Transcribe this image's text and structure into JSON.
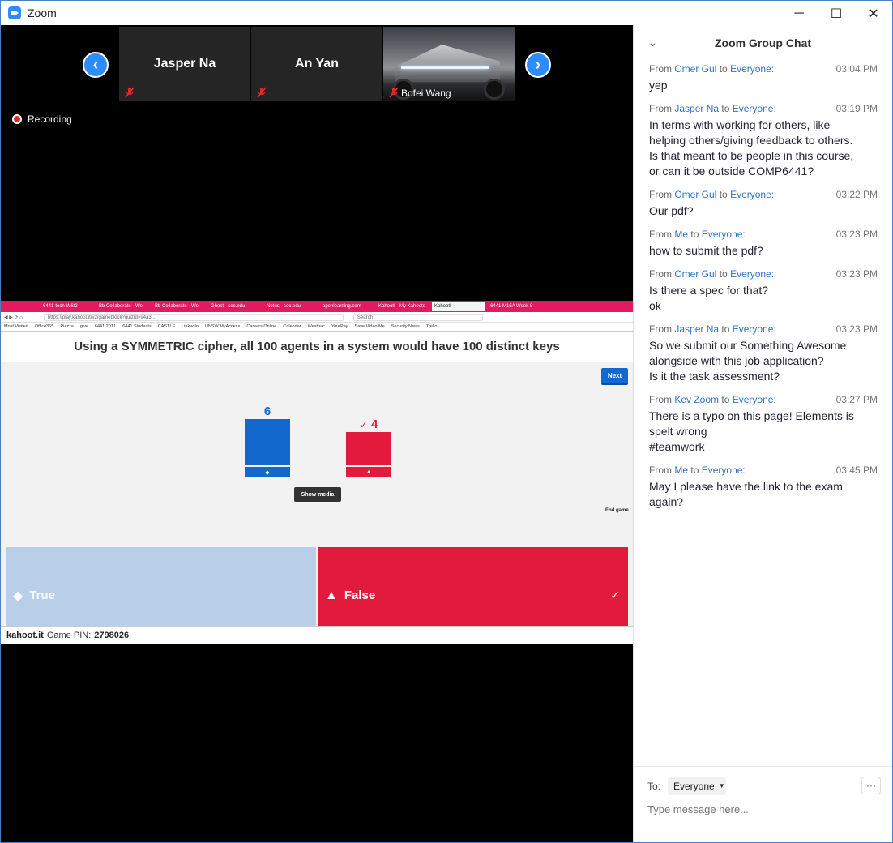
{
  "window": {
    "title": "Zoom",
    "minimize": "─",
    "maximize": "☐",
    "close": "✕"
  },
  "gallery": {
    "prev": "‹",
    "next": "›",
    "participants": [
      {
        "name": "Jasper Na"
      },
      {
        "name": "An Yan"
      },
      {
        "name": "Bofei Wang"
      }
    ]
  },
  "recording": {
    "label": "Recording"
  },
  "browser": {
    "tabs": [
      "6441-tech-W6t2",
      "Bb Collaborate - We",
      "Bb Collaborate - We",
      "Ghost - sec.edu",
      "Notes - sec.edu",
      "openlearning.com",
      "Kahoot! - My Kahoots",
      "Kahoot!",
      "6441 M15A Week 8"
    ],
    "url": "https://play.kahoot.it/v2/gameblock?quizId=94a3...",
    "search": "Search",
    "bookmarks": [
      "Most Visited",
      "Office365",
      "Piazza",
      "give",
      "6441 20T1",
      "6441 Students",
      "CASTLE",
      "LinkedIn",
      "UNSW MyAccess",
      "Careers Online",
      "Calendar",
      "Westpac",
      "YourPay",
      "Save Video Me",
      "Security News",
      "Trello"
    ]
  },
  "kahoot": {
    "question": "Using a SYMMETRIC cipher, all 100 agents in a system would have 100 distinct keys",
    "next_label": "Next",
    "show_media": "Show media",
    "end_game": "End game",
    "results": [
      {
        "label": "True",
        "count": "6",
        "color": "#1368ce",
        "symbol": "◆",
        "correct": false
      },
      {
        "label": "False",
        "count": "4",
        "color": "#e21b3c",
        "symbol": "▲",
        "correct": true
      }
    ],
    "correct_mark": "✓",
    "footer": {
      "site": "kahoot.it",
      "pin_label": "Game PIN:",
      "pin": "2798026"
    }
  },
  "chat": {
    "title": "Zoom Group Chat",
    "messages": [
      {
        "from_label": "From",
        "sender": "Omer Gul",
        "to_label": "to",
        "recipient": "Everyone:",
        "time": "03:04 PM",
        "lines": [
          "yep"
        ]
      },
      {
        "from_label": "From",
        "sender": "Jasper Na",
        "to_label": "to",
        "recipient": "Everyone:",
        "time": "03:19 PM",
        "lines": [
          "In terms with working for others, like",
          "helping others/giving feedback to others.",
          "Is that meant to be people in this course,",
          "or can it be outside COMP6441?"
        ]
      },
      {
        "from_label": "From",
        "sender": "Omer Gul",
        "to_label": "to",
        "recipient": "Everyone:",
        "time": "03:22 PM",
        "lines": [
          "Our pdf?"
        ]
      },
      {
        "from_label": "From",
        "sender": "Me",
        "to_label": "to",
        "recipient": "Everyone:",
        "time": "03:23 PM",
        "lines": [
          "how to submit the pdf?"
        ]
      },
      {
        "from_label": "From",
        "sender": "Omer Gul",
        "to_label": "to",
        "recipient": "Everyone:",
        "time": "03:23 PM",
        "lines": [
          "Is there a spec for that?",
          "ok"
        ]
      },
      {
        "from_label": "From",
        "sender": "Jasper Na",
        "to_label": "to",
        "recipient": "Everyone:",
        "time": "03:23 PM",
        "lines": [
          "So we submit our Something Awesome",
          "alongside with this job application?",
          "Is it the task assessment?"
        ]
      },
      {
        "from_label": "From",
        "sender": "Kev Zoom",
        "to_label": "to",
        "recipient": "Everyone:",
        "time": "03:27 PM",
        "lines": [
          "There is a typo on this page! Elements is",
          "spelt wrong",
          "#teamwork"
        ]
      },
      {
        "from_label": "From",
        "sender": "Me",
        "to_label": "to",
        "recipient": "Everyone:",
        "time": "03:45 PM",
        "lines": [
          "May I please have the link to the exam",
          "again?"
        ]
      }
    ],
    "to_label": "To:",
    "to_value": "Everyone",
    "more": "···",
    "placeholder": "Type message here..."
  }
}
